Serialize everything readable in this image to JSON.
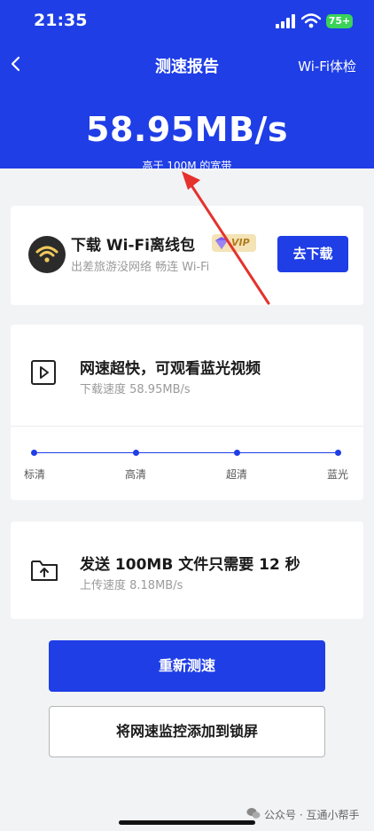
{
  "status_bar": {
    "time": "21:35",
    "battery": "75+"
  },
  "nav": {
    "title": "测速报告",
    "right_link": "Wi-Fi体检"
  },
  "result": {
    "speed": "58.95MB/s",
    "comparison": "高于 100M 的宽带"
  },
  "offline_pack": {
    "title": "下载 Wi-Fi离线包",
    "badge": "VIP",
    "subtitle": "出差旅游没网络 畅连 Wi-Fi",
    "button": "去下载"
  },
  "download_info": {
    "title": "网速超快，可观看蓝光视频",
    "detail": "下载速度 58.95MB/s",
    "quality_levels": [
      "标清",
      "高清",
      "超清",
      "蓝光"
    ]
  },
  "upload_info": {
    "title": "发送 100MB 文件只需要 12 秒",
    "detail": "上传速度 8.18MB/s"
  },
  "actions": {
    "retest": "重新测速",
    "add_lockscreen": "将网速监控添加到锁屏"
  },
  "watermark": "公众号 · 互通小帮手",
  "colors": {
    "brand_blue": "#1f3ee6",
    "annotation_red": "#e5322d",
    "vip_gold": "#b07d1c"
  }
}
